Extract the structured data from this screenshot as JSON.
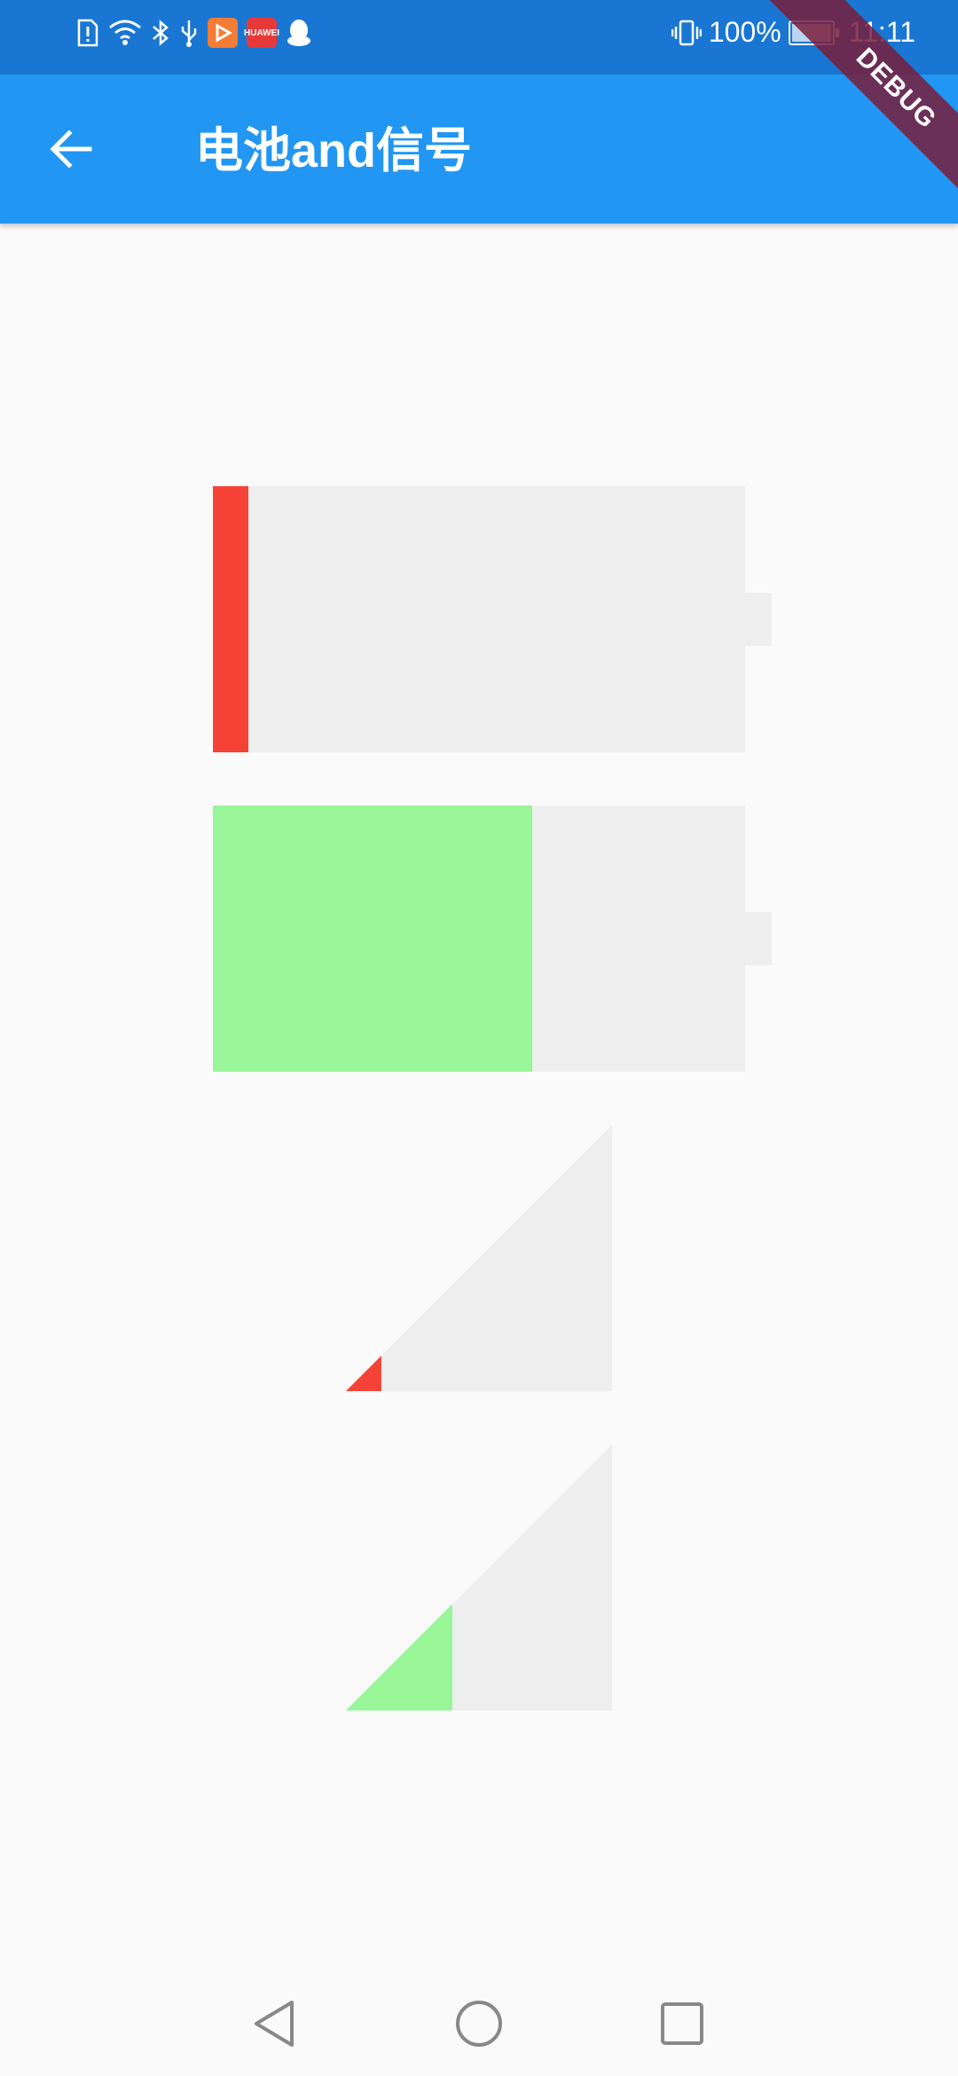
{
  "status_bar": {
    "battery_percent": "100%",
    "time": "11:11",
    "left_icons": [
      "sim-alert-icon",
      "wifi-icon",
      "bluetooth-icon",
      "usb-icon",
      "video-app-icon",
      "huawei-store-icon",
      "qq-icon"
    ],
    "app_badge_huawei": "HUAWEI",
    "background": "#1976d2"
  },
  "app_bar": {
    "title": "电池and信号",
    "background": "#2196f3"
  },
  "debug_banner": "DEBUG",
  "widgets": {
    "battery_low": {
      "level": 0.067,
      "color": "#f44336",
      "track": "#eeeeee"
    },
    "battery_high": {
      "level": 0.6,
      "color": "#98f598",
      "track": "#eeeeee"
    },
    "signal_low": {
      "level": 0.133,
      "color": "#f44336",
      "track": "#eeeeee"
    },
    "signal_high": {
      "level": 0.4,
      "color": "#98f598",
      "track": "#eeeeee"
    }
  },
  "nav_bar": {
    "icons": [
      "back-triangle-icon",
      "home-circle-icon",
      "recents-square-icon"
    ]
  }
}
